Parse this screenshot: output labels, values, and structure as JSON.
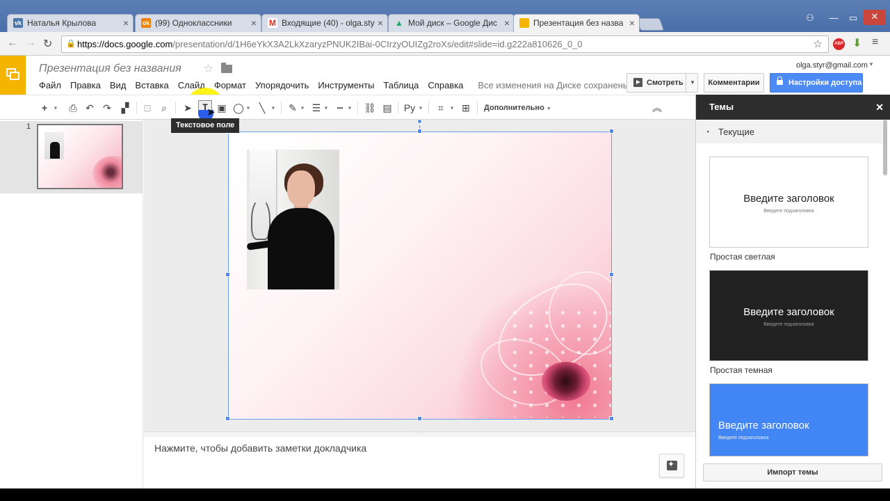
{
  "browser": {
    "tabs": [
      {
        "title": "Наталья Крылова",
        "icon": "vk-icon",
        "color": "#4a76a8",
        "favicon_text": "vk"
      },
      {
        "title": "(99) Одноклассники",
        "icon": "odnoklassniki-icon",
        "color": "#ee8208",
        "favicon_text": "ok"
      },
      {
        "title": "Входящие (40) - olga.sty",
        "icon": "gmail-icon",
        "color": "#d93025",
        "favicon_text": "M"
      },
      {
        "title": "Мой диск – Google Дис",
        "icon": "google-drive-icon",
        "color": "#1fa463",
        "favicon_text": "▲"
      },
      {
        "title": "Презентация без назва",
        "icon": "google-slides-icon",
        "color": "#f4b400",
        "favicon_text": ""
      }
    ],
    "url_host": "https://docs.google.com",
    "url_path": "/presentation/d/1H6eYkX3A2LkXzaryzPNUK2IBai-0CIrzyOUIZg2roXs/edit#slide=id.g222a810626_0_0",
    "ext_abp": "ABP"
  },
  "doc": {
    "title": "Презентация без названия",
    "menus": [
      "Файл",
      "Правка",
      "Вид",
      "Вставка",
      "Слайд",
      "Формат",
      "Упорядочить",
      "Инструменты",
      "Таблица",
      "Справка"
    ],
    "save_status": "Все изменения на Диске сохранены",
    "user_email": "olga.styr@gmail.com",
    "present_label": "Смотреть",
    "comments_label": "Комментарии",
    "share_label": "Настройки доступа"
  },
  "toolbar": {
    "more_label": "Дополнительно",
    "tooltip": "Текстовое поле",
    "input_tools_label": "Ру"
  },
  "filmstrip": {
    "slide_number": "1"
  },
  "notes": {
    "placeholder": "Нажмите, чтобы добавить заметки докладчика"
  },
  "themes": {
    "header": "Темы",
    "current_label": "Текущие",
    "items": [
      {
        "title": "Введите заголовок",
        "subtitle": "Введите подзаголовок",
        "name": "Простая светлая",
        "bg": "#ffffff",
        "fg": "#222222",
        "sub_fg": "#777777"
      },
      {
        "title": "Введите заголовок",
        "subtitle": "Введите подзаголовок",
        "name": "Простая темная",
        "bg": "#212121",
        "fg": "#ffffff",
        "sub_fg": "#9e9e9e"
      },
      {
        "title": "Введите заголовок",
        "subtitle": "Введите подзаголовок",
        "name": "",
        "bg": "#4285f4",
        "fg": "#ffffff",
        "sub_fg": "#e8eefc"
      }
    ],
    "import_label": "Импорт темы"
  },
  "colors": {
    "accent_blue": "#4c8bf5",
    "slides_yellow": "#f4b400",
    "tab_strip": "#5b7fb5"
  }
}
